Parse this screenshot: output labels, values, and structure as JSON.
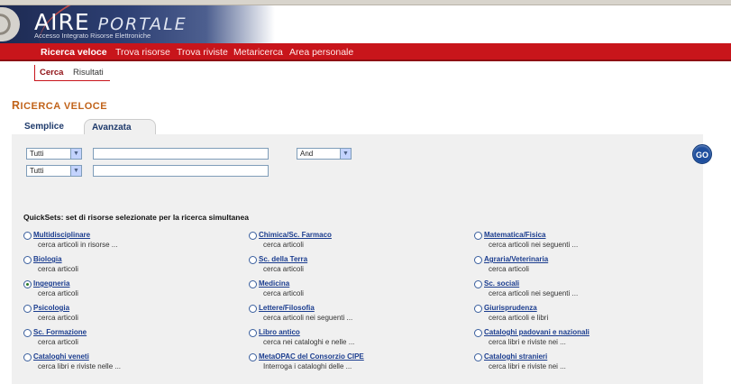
{
  "header": {
    "logo_main": "AIRE",
    "logo_accent": "PORTALE",
    "logo_subtitle": "Accesso Integrato Risorse Elettroniche"
  },
  "nav": {
    "items": [
      {
        "label": "Ricerca veloce",
        "active": true
      },
      {
        "label": "Trova risorse",
        "active": false
      },
      {
        "label": "Trova riviste",
        "active": false
      },
      {
        "label": "Metaricerca",
        "active": false
      },
      {
        "label": "Area personale",
        "active": false
      }
    ]
  },
  "subnav": {
    "items": [
      {
        "label": "Cerca",
        "selected": true
      },
      {
        "label": "Risultati",
        "selected": false
      }
    ]
  },
  "page": {
    "title_first": "R",
    "title_rest": "ICERCA VELOCE"
  },
  "tabs": [
    {
      "label": "Semplice",
      "active": false
    },
    {
      "label": "Avanzata",
      "active": true
    }
  ],
  "search": {
    "row1": {
      "field": "Tutti",
      "value": "",
      "operator": "And"
    },
    "row2": {
      "field": "Tutti",
      "value": ""
    },
    "go_label": "GO"
  },
  "quicksets": {
    "title": "QuickSets: set di risorse selezionate per la ricerca simultanea",
    "columns": [
      [
        {
          "label": "Multidisciplinare",
          "desc": "cerca articoli in risorse ...",
          "checked": false
        },
        {
          "label": "Biologia",
          "desc": "cerca articoli",
          "checked": false
        },
        {
          "label": "Ingegneria",
          "desc": "cerca articoli",
          "checked": true
        },
        {
          "label": "Psicologia",
          "desc": "cerca articoli",
          "checked": false
        },
        {
          "label": "Sc. Formazione",
          "desc": "cerca articoli",
          "checked": false
        },
        {
          "label": "Cataloghi veneti",
          "desc": "cerca libri e riviste nelle ...",
          "checked": false
        }
      ],
      [
        {
          "label": "Chimica/Sc. Farmaco",
          "desc": "cerca articoli",
          "checked": false
        },
        {
          "label": "Sc. della Terra",
          "desc": "cerca articoli",
          "checked": false
        },
        {
          "label": "Medicina",
          "desc": "cerca articoli",
          "checked": false
        },
        {
          "label": "Lettere/Filosofia",
          "desc": "cerca articoli nei seguenti ...",
          "checked": false
        },
        {
          "label": "Libro antico",
          "desc": "cerca nei cataloghi e nelle ...",
          "checked": false
        },
        {
          "label": "MetaOPAC del Consorzio CIPE",
          "desc": "Interroga i cataloghi delle ...",
          "checked": false
        }
      ],
      [
        {
          "label": "Matematica/Fisica",
          "desc": "cerca articoli nei seguenti ...",
          "checked": false
        },
        {
          "label": "Agraria/Veterinaria",
          "desc": "cerca articoli",
          "checked": false
        },
        {
          "label": "Sc. sociali",
          "desc": "cerca articoli nei seguenti ...",
          "checked": false
        },
        {
          "label": "Giurisprudenza",
          "desc": "cerca articoli e libri",
          "checked": false
        },
        {
          "label": "Cataloghi padovani e nazionali",
          "desc": "cerca libri e riviste nei ...",
          "checked": false
        },
        {
          "label": "Cataloghi stranieri",
          "desc": "cerca libri e riviste nei ...",
          "checked": false
        }
      ]
    ]
  }
}
